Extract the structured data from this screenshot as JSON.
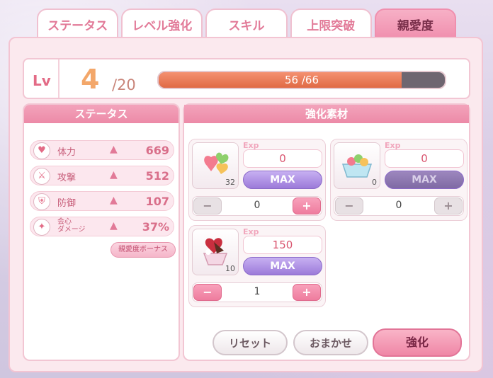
{
  "tabs": [
    {
      "label": "ステータス",
      "active": false
    },
    {
      "label": "レベル強化",
      "active": false
    },
    {
      "label": "スキル",
      "active": false
    },
    {
      "label": "上限突破",
      "active": false
    },
    {
      "label": "親愛度",
      "active": true
    }
  ],
  "level": {
    "label": "Lv",
    "current": "4",
    "max": "/20",
    "exp_text": "56 /66",
    "exp_fraction": 0.848
  },
  "status": {
    "title": "ステータス",
    "rows": [
      {
        "icon": "heart-icon",
        "label": "体力",
        "value": "669"
      },
      {
        "icon": "sword-icon",
        "label": "攻撃",
        "value": "512"
      },
      {
        "icon": "shield-icon",
        "label": "防御",
        "value": "107"
      },
      {
        "icon": "critical-icon",
        "label": "会心\nダメージ",
        "value": "37%"
      }
    ],
    "bonus_button": "親愛度ボーナス"
  },
  "materials": {
    "title": "強化素材",
    "exp_tag": "Exp",
    "items": [
      {
        "name": "heart-candy-item",
        "count": "32",
        "exp": "0",
        "max_label": "MAX",
        "max_enabled": true,
        "quantity": "0",
        "minus_enabled": false,
        "plus_enabled": true
      },
      {
        "name": "fruit-jelly-item",
        "count": "0",
        "exp": "0",
        "max_label": "MAX",
        "max_enabled": false,
        "quantity": "0",
        "minus_enabled": false,
        "plus_enabled": false
      },
      {
        "name": "chocolate-parfait-item",
        "count": "10",
        "exp": "150",
        "max_label": "MAX",
        "max_enabled": true,
        "quantity": "1",
        "minus_enabled": true,
        "plus_enabled": true
      }
    ],
    "minus_symbol": "−",
    "plus_symbol": "+"
  },
  "actions": {
    "reset": "リセット",
    "auto": "おまかせ",
    "enhance": "強化"
  },
  "colors": {
    "accent_pink": "#f08fae",
    "exp_bar": "#e06a45",
    "max_purple": "#9c7ad9"
  }
}
